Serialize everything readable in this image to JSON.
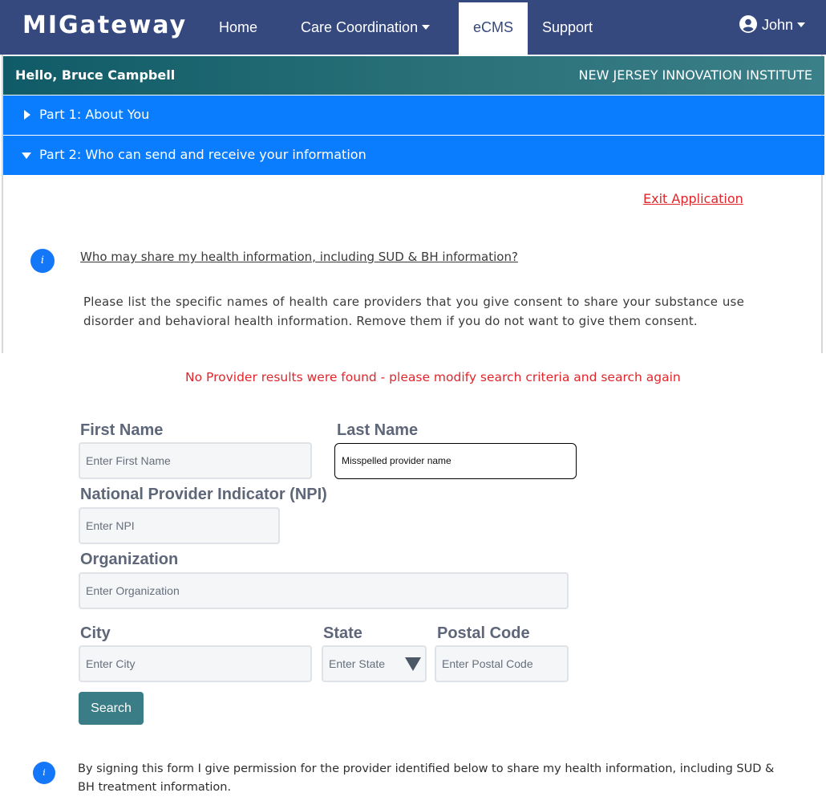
{
  "navbar": {
    "logo": "MIGateway",
    "links": {
      "home": "Home",
      "care_coordination": "Care Coordination",
      "ecms": "eCMS",
      "support": "Support"
    },
    "user": "John",
    "colors": {
      "background": "#35497f",
      "active_tab_bg": "#ffffff"
    }
  },
  "header": {
    "greeting": "Hello, Bruce Campbell",
    "organization": "NEW JERSEY INNOVATION INSTITUTE"
  },
  "accordion": {
    "part1": "Part 1: About You",
    "part2": "Part 2: Who can send and receive your information",
    "color": "#0a7dff"
  },
  "exit_link": "Exit Application",
  "info_icon_glyph": "i",
  "question": "Who may share my health information, including SUD & BH information?",
  "instructions": "Please list the specific names of health care providers that you give consent to share your substance use disorder and behavioral health information. Remove them if you do not want to give them consent.",
  "search": {
    "error_message": "No Provider results were found - please modify search criteria and search again",
    "first_name": {
      "label": "First Name",
      "placeholder": "Enter First Name",
      "value": ""
    },
    "last_name": {
      "label": "Last Name",
      "placeholder": "",
      "value": "Misspelled provider name"
    },
    "npi": {
      "label": "National Provider Indicator (NPI)",
      "placeholder": "Enter NPI",
      "value": ""
    },
    "organization": {
      "label": "Organization",
      "placeholder": "Enter Organization",
      "value": ""
    },
    "city": {
      "label": "City",
      "placeholder": "Enter City",
      "value": ""
    },
    "state": {
      "label": "State",
      "placeholder": "Enter State",
      "value": ""
    },
    "postal_code": {
      "label": "Postal Code",
      "placeholder": "Enter Postal Code",
      "value": ""
    },
    "button": "Search",
    "button_color": "#3b7d86",
    "error_color": "#e0262b"
  },
  "consent": "By signing this form I give permission for the provider identified below to share my health information, including SUD & BH treatment information."
}
